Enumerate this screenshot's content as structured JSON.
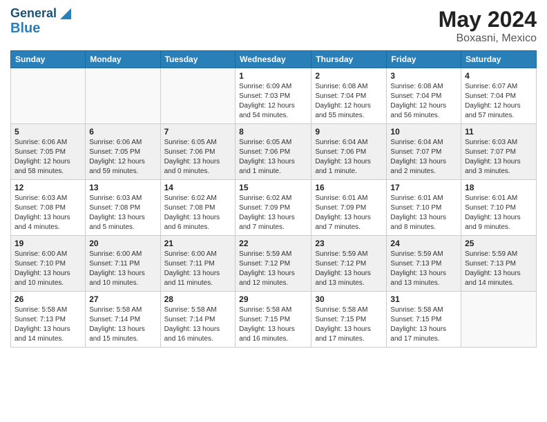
{
  "header": {
    "logo_general": "General",
    "logo_blue": "Blue",
    "title": "May 2024",
    "location": "Boxasni, Mexico"
  },
  "days_of_week": [
    "Sunday",
    "Monday",
    "Tuesday",
    "Wednesday",
    "Thursday",
    "Friday",
    "Saturday"
  ],
  "weeks": [
    [
      {
        "day": "",
        "sunrise": "",
        "sunset": "",
        "daylight": "",
        "empty": true
      },
      {
        "day": "",
        "sunrise": "",
        "sunset": "",
        "daylight": "",
        "empty": true
      },
      {
        "day": "",
        "sunrise": "",
        "sunset": "",
        "daylight": "",
        "empty": true
      },
      {
        "day": "1",
        "sunrise": "Sunrise: 6:09 AM",
        "sunset": "Sunset: 7:03 PM",
        "daylight": "Daylight: 12 hours and 54 minutes.",
        "empty": false
      },
      {
        "day": "2",
        "sunrise": "Sunrise: 6:08 AM",
        "sunset": "Sunset: 7:04 PM",
        "daylight": "Daylight: 12 hours and 55 minutes.",
        "empty": false
      },
      {
        "day": "3",
        "sunrise": "Sunrise: 6:08 AM",
        "sunset": "Sunset: 7:04 PM",
        "daylight": "Daylight: 12 hours and 56 minutes.",
        "empty": false
      },
      {
        "day": "4",
        "sunrise": "Sunrise: 6:07 AM",
        "sunset": "Sunset: 7:04 PM",
        "daylight": "Daylight: 12 hours and 57 minutes.",
        "empty": false
      }
    ],
    [
      {
        "day": "5",
        "sunrise": "Sunrise: 6:06 AM",
        "sunset": "Sunset: 7:05 PM",
        "daylight": "Daylight: 12 hours and 58 minutes.",
        "empty": false
      },
      {
        "day": "6",
        "sunrise": "Sunrise: 6:06 AM",
        "sunset": "Sunset: 7:05 PM",
        "daylight": "Daylight: 12 hours and 59 minutes.",
        "empty": false
      },
      {
        "day": "7",
        "sunrise": "Sunrise: 6:05 AM",
        "sunset": "Sunset: 7:06 PM",
        "daylight": "Daylight: 13 hours and 0 minutes.",
        "empty": false
      },
      {
        "day": "8",
        "sunrise": "Sunrise: 6:05 AM",
        "sunset": "Sunset: 7:06 PM",
        "daylight": "Daylight: 13 hours and 1 minute.",
        "empty": false
      },
      {
        "day": "9",
        "sunrise": "Sunrise: 6:04 AM",
        "sunset": "Sunset: 7:06 PM",
        "daylight": "Daylight: 13 hours and 1 minute.",
        "empty": false
      },
      {
        "day": "10",
        "sunrise": "Sunrise: 6:04 AM",
        "sunset": "Sunset: 7:07 PM",
        "daylight": "Daylight: 13 hours and 2 minutes.",
        "empty": false
      },
      {
        "day": "11",
        "sunrise": "Sunrise: 6:03 AM",
        "sunset": "Sunset: 7:07 PM",
        "daylight": "Daylight: 13 hours and 3 minutes.",
        "empty": false
      }
    ],
    [
      {
        "day": "12",
        "sunrise": "Sunrise: 6:03 AM",
        "sunset": "Sunset: 7:08 PM",
        "daylight": "Daylight: 13 hours and 4 minutes.",
        "empty": false
      },
      {
        "day": "13",
        "sunrise": "Sunrise: 6:03 AM",
        "sunset": "Sunset: 7:08 PM",
        "daylight": "Daylight: 13 hours and 5 minutes.",
        "empty": false
      },
      {
        "day": "14",
        "sunrise": "Sunrise: 6:02 AM",
        "sunset": "Sunset: 7:08 PM",
        "daylight": "Daylight: 13 hours and 6 minutes.",
        "empty": false
      },
      {
        "day": "15",
        "sunrise": "Sunrise: 6:02 AM",
        "sunset": "Sunset: 7:09 PM",
        "daylight": "Daylight: 13 hours and 7 minutes.",
        "empty": false
      },
      {
        "day": "16",
        "sunrise": "Sunrise: 6:01 AM",
        "sunset": "Sunset: 7:09 PM",
        "daylight": "Daylight: 13 hours and 7 minutes.",
        "empty": false
      },
      {
        "day": "17",
        "sunrise": "Sunrise: 6:01 AM",
        "sunset": "Sunset: 7:10 PM",
        "daylight": "Daylight: 13 hours and 8 minutes.",
        "empty": false
      },
      {
        "day": "18",
        "sunrise": "Sunrise: 6:01 AM",
        "sunset": "Sunset: 7:10 PM",
        "daylight": "Daylight: 13 hours and 9 minutes.",
        "empty": false
      }
    ],
    [
      {
        "day": "19",
        "sunrise": "Sunrise: 6:00 AM",
        "sunset": "Sunset: 7:10 PM",
        "daylight": "Daylight: 13 hours and 10 minutes.",
        "empty": false
      },
      {
        "day": "20",
        "sunrise": "Sunrise: 6:00 AM",
        "sunset": "Sunset: 7:11 PM",
        "daylight": "Daylight: 13 hours and 10 minutes.",
        "empty": false
      },
      {
        "day": "21",
        "sunrise": "Sunrise: 6:00 AM",
        "sunset": "Sunset: 7:11 PM",
        "daylight": "Daylight: 13 hours and 11 minutes.",
        "empty": false
      },
      {
        "day": "22",
        "sunrise": "Sunrise: 5:59 AM",
        "sunset": "Sunset: 7:12 PM",
        "daylight": "Daylight: 13 hours and 12 minutes.",
        "empty": false
      },
      {
        "day": "23",
        "sunrise": "Sunrise: 5:59 AM",
        "sunset": "Sunset: 7:12 PM",
        "daylight": "Daylight: 13 hours and 13 minutes.",
        "empty": false
      },
      {
        "day": "24",
        "sunrise": "Sunrise: 5:59 AM",
        "sunset": "Sunset: 7:13 PM",
        "daylight": "Daylight: 13 hours and 13 minutes.",
        "empty": false
      },
      {
        "day": "25",
        "sunrise": "Sunrise: 5:59 AM",
        "sunset": "Sunset: 7:13 PM",
        "daylight": "Daylight: 13 hours and 14 minutes.",
        "empty": false
      }
    ],
    [
      {
        "day": "26",
        "sunrise": "Sunrise: 5:58 AM",
        "sunset": "Sunset: 7:13 PM",
        "daylight": "Daylight: 13 hours and 14 minutes.",
        "empty": false
      },
      {
        "day": "27",
        "sunrise": "Sunrise: 5:58 AM",
        "sunset": "Sunset: 7:14 PM",
        "daylight": "Daylight: 13 hours and 15 minutes.",
        "empty": false
      },
      {
        "day": "28",
        "sunrise": "Sunrise: 5:58 AM",
        "sunset": "Sunset: 7:14 PM",
        "daylight": "Daylight: 13 hours and 16 minutes.",
        "empty": false
      },
      {
        "day": "29",
        "sunrise": "Sunrise: 5:58 AM",
        "sunset": "Sunset: 7:15 PM",
        "daylight": "Daylight: 13 hours and 16 minutes.",
        "empty": false
      },
      {
        "day": "30",
        "sunrise": "Sunrise: 5:58 AM",
        "sunset": "Sunset: 7:15 PM",
        "daylight": "Daylight: 13 hours and 17 minutes.",
        "empty": false
      },
      {
        "day": "31",
        "sunrise": "Sunrise: 5:58 AM",
        "sunset": "Sunset: 7:15 PM",
        "daylight": "Daylight: 13 hours and 17 minutes.",
        "empty": false
      },
      {
        "day": "",
        "sunrise": "",
        "sunset": "",
        "daylight": "",
        "empty": true
      }
    ]
  ]
}
